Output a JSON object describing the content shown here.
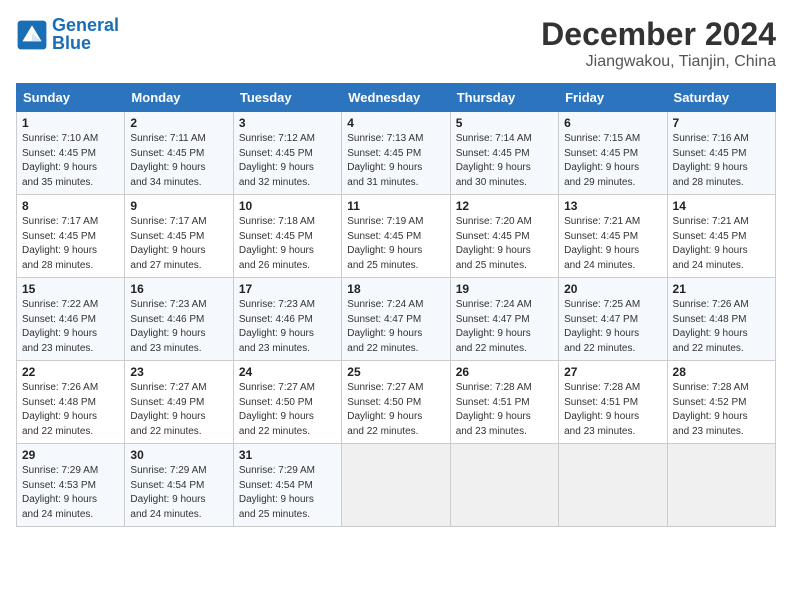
{
  "header": {
    "logo_line1": "General",
    "logo_line2": "Blue",
    "title": "December 2024",
    "subtitle": "Jiangwakou, Tianjin, China"
  },
  "days_of_week": [
    "Sunday",
    "Monday",
    "Tuesday",
    "Wednesday",
    "Thursday",
    "Friday",
    "Saturday"
  ],
  "weeks": [
    [
      {
        "day": "1",
        "info": "Sunrise: 7:10 AM\nSunset: 4:45 PM\nDaylight: 9 hours\nand 35 minutes."
      },
      {
        "day": "2",
        "info": "Sunrise: 7:11 AM\nSunset: 4:45 PM\nDaylight: 9 hours\nand 34 minutes."
      },
      {
        "day": "3",
        "info": "Sunrise: 7:12 AM\nSunset: 4:45 PM\nDaylight: 9 hours\nand 32 minutes."
      },
      {
        "day": "4",
        "info": "Sunrise: 7:13 AM\nSunset: 4:45 PM\nDaylight: 9 hours\nand 31 minutes."
      },
      {
        "day": "5",
        "info": "Sunrise: 7:14 AM\nSunset: 4:45 PM\nDaylight: 9 hours\nand 30 minutes."
      },
      {
        "day": "6",
        "info": "Sunrise: 7:15 AM\nSunset: 4:45 PM\nDaylight: 9 hours\nand 29 minutes."
      },
      {
        "day": "7",
        "info": "Sunrise: 7:16 AM\nSunset: 4:45 PM\nDaylight: 9 hours\nand 28 minutes."
      }
    ],
    [
      {
        "day": "8",
        "info": "Sunrise: 7:17 AM\nSunset: 4:45 PM\nDaylight: 9 hours\nand 28 minutes."
      },
      {
        "day": "9",
        "info": "Sunrise: 7:17 AM\nSunset: 4:45 PM\nDaylight: 9 hours\nand 27 minutes."
      },
      {
        "day": "10",
        "info": "Sunrise: 7:18 AM\nSunset: 4:45 PM\nDaylight: 9 hours\nand 26 minutes."
      },
      {
        "day": "11",
        "info": "Sunrise: 7:19 AM\nSunset: 4:45 PM\nDaylight: 9 hours\nand 25 minutes."
      },
      {
        "day": "12",
        "info": "Sunrise: 7:20 AM\nSunset: 4:45 PM\nDaylight: 9 hours\nand 25 minutes."
      },
      {
        "day": "13",
        "info": "Sunrise: 7:21 AM\nSunset: 4:45 PM\nDaylight: 9 hours\nand 24 minutes."
      },
      {
        "day": "14",
        "info": "Sunrise: 7:21 AM\nSunset: 4:45 PM\nDaylight: 9 hours\nand 24 minutes."
      }
    ],
    [
      {
        "day": "15",
        "info": "Sunrise: 7:22 AM\nSunset: 4:46 PM\nDaylight: 9 hours\nand 23 minutes."
      },
      {
        "day": "16",
        "info": "Sunrise: 7:23 AM\nSunset: 4:46 PM\nDaylight: 9 hours\nand 23 minutes."
      },
      {
        "day": "17",
        "info": "Sunrise: 7:23 AM\nSunset: 4:46 PM\nDaylight: 9 hours\nand 23 minutes."
      },
      {
        "day": "18",
        "info": "Sunrise: 7:24 AM\nSunset: 4:47 PM\nDaylight: 9 hours\nand 22 minutes."
      },
      {
        "day": "19",
        "info": "Sunrise: 7:24 AM\nSunset: 4:47 PM\nDaylight: 9 hours\nand 22 minutes."
      },
      {
        "day": "20",
        "info": "Sunrise: 7:25 AM\nSunset: 4:47 PM\nDaylight: 9 hours\nand 22 minutes."
      },
      {
        "day": "21",
        "info": "Sunrise: 7:26 AM\nSunset: 4:48 PM\nDaylight: 9 hours\nand 22 minutes."
      }
    ],
    [
      {
        "day": "22",
        "info": "Sunrise: 7:26 AM\nSunset: 4:48 PM\nDaylight: 9 hours\nand 22 minutes."
      },
      {
        "day": "23",
        "info": "Sunrise: 7:27 AM\nSunset: 4:49 PM\nDaylight: 9 hours\nand 22 minutes."
      },
      {
        "day": "24",
        "info": "Sunrise: 7:27 AM\nSunset: 4:50 PM\nDaylight: 9 hours\nand 22 minutes."
      },
      {
        "day": "25",
        "info": "Sunrise: 7:27 AM\nSunset: 4:50 PM\nDaylight: 9 hours\nand 22 minutes."
      },
      {
        "day": "26",
        "info": "Sunrise: 7:28 AM\nSunset: 4:51 PM\nDaylight: 9 hours\nand 23 minutes."
      },
      {
        "day": "27",
        "info": "Sunrise: 7:28 AM\nSunset: 4:51 PM\nDaylight: 9 hours\nand 23 minutes."
      },
      {
        "day": "28",
        "info": "Sunrise: 7:28 AM\nSunset: 4:52 PM\nDaylight: 9 hours\nand 23 minutes."
      }
    ],
    [
      {
        "day": "29",
        "info": "Sunrise: 7:29 AM\nSunset: 4:53 PM\nDaylight: 9 hours\nand 24 minutes."
      },
      {
        "day": "30",
        "info": "Sunrise: 7:29 AM\nSunset: 4:54 PM\nDaylight: 9 hours\nand 24 minutes."
      },
      {
        "day": "31",
        "info": "Sunrise: 7:29 AM\nSunset: 4:54 PM\nDaylight: 9 hours\nand 25 minutes."
      },
      null,
      null,
      null,
      null
    ]
  ]
}
